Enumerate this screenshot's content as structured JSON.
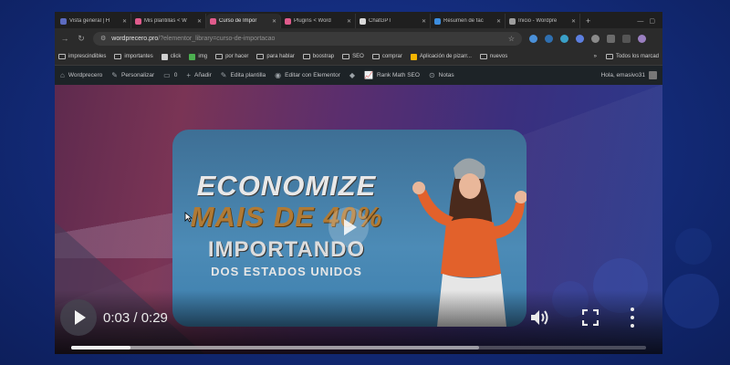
{
  "browser": {
    "tabs": [
      {
        "title": "Vista general | H",
        "active": false,
        "favicon_color": "#5c6bc0",
        "favicon": "lines-logo-icon"
      },
      {
        "title": "Mis plantillas < W",
        "active": false,
        "favicon_color": "#e05b8c",
        "favicon": "elementor-icon"
      },
      {
        "title": "Curso de Impor",
        "active": true,
        "favicon_color": "#e05b8c",
        "favicon": "elementor-icon"
      },
      {
        "title": "Plugins < Word",
        "active": false,
        "favicon_color": "#e05b8c",
        "favicon": "elementor-icon"
      },
      {
        "title": "ChatGPT",
        "active": false,
        "favicon_color": "#d9d9d9",
        "favicon": "chatgpt-icon"
      },
      {
        "title": "Resumen de fac",
        "active": false,
        "favicon_color": "#3c8dde",
        "favicon": "ads-icon"
      },
      {
        "title": "Inicio - Wordpre",
        "active": false,
        "favicon_color": "#9e9e9e",
        "favicon": "wordpress-icon"
      }
    ],
    "url": {
      "host": "wordprecero.pro",
      "path": "/?elementor_library=curso-de-importacao"
    },
    "bookmarks": [
      {
        "label": "imprescindibles",
        "type": "folder"
      },
      {
        "label": "importantes",
        "type": "folder"
      },
      {
        "label": "click",
        "type": "site",
        "color": "#cfcfcf"
      },
      {
        "label": "img",
        "type": "site",
        "color": "#4caf50"
      },
      {
        "label": "por hacer",
        "type": "folder"
      },
      {
        "label": "para hablar",
        "type": "folder"
      },
      {
        "label": "boostrap",
        "type": "folder"
      },
      {
        "label": "SEO",
        "type": "folder"
      },
      {
        "label": "comprar",
        "type": "folder"
      },
      {
        "label": "Aplicación de pizarr...",
        "type": "site",
        "color": "#f4b400"
      },
      {
        "label": "nuevos",
        "type": "folder"
      }
    ],
    "bookmarks_more": "»",
    "all_bookmarks": "Todos los marcad"
  },
  "wp_admin_bar": {
    "site_name": "Wordprecero",
    "customize": "Personalizar",
    "comments": "0",
    "add_new": "Añadir",
    "edit_template": "Edita plantilla",
    "edit_elementor": "Editar con Elementor",
    "rank_math": "Rank Math SEO",
    "notes": "Notas",
    "greeting": "Hola, emasivo31"
  },
  "video": {
    "headline_1": "ECONOMIZE",
    "headline_2": "MAIS DE 40%",
    "headline_3": "IMPORTANDO",
    "headline_4": "DOS ESTADOS UNIDOS",
    "timecode": "0:03 / 0:29",
    "current_seconds": 3,
    "duration_seconds": 29,
    "buffered_fraction": 0.71
  },
  "colors": {
    "accent_orange": "#b07a35",
    "wp_bar": "#1d2327",
    "chrome_bg": "#2b2b2b"
  }
}
